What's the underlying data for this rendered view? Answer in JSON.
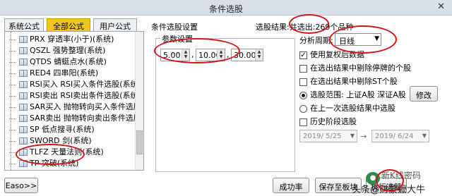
{
  "window": {
    "title": "条件选股",
    "close_glyph": "✕"
  },
  "tabs": [
    {
      "label": "系统公式",
      "active": false
    },
    {
      "label": "全部公式",
      "active": true
    },
    {
      "label": "用户公式",
      "active": false
    }
  ],
  "tree": {
    "items": [
      "PRX 穿透率(小于)(系统)",
      "QSZL 强势整理(系统)",
      "QTDS 蜻蜓点水(系统)",
      "RED4 四串阳(系统)",
      "RSI买入 RSI买入条件选股(系统)",
      "RSI卖出 RSI卖出条件选股(系统)",
      "SAR买入 抛物转向买入条件选股(",
      "SAR卖出 抛物转向卖出条件选股(系",
      "SP 低点搜寻(系统)",
      "SWORD 剑(系统)",
      "TLFZ 天量法则(系统)",
      "TP 突破(系统)"
    ]
  },
  "right": {
    "section_label": "条件选股设置",
    "result_label": "选股结果:共选出:269个品种",
    "params_label": "参数设置",
    "params": [
      "5.00",
      "10.00",
      "30.00"
    ],
    "period_label": "分析周期:",
    "period_value": "日线",
    "options": [
      {
        "label": "使用复权后数据",
        "checked": true
      },
      {
        "label": "在选出结果中剔除停牌的个股",
        "checked": false
      },
      {
        "label": "在选出结果中剔除ST个股",
        "checked": false
      }
    ],
    "scope_radio_1": "选股范围: 上证A股 深证A股",
    "scope_radio_2": "在上一次选股结果中选股",
    "history_label": "历史阶段选股",
    "modify_button": "修改",
    "date_from": "2019/ 5/25",
    "date_to": "2019/ 6/24",
    "date_sep": "→"
  },
  "bottom": {
    "advanced_button": "Easo>>",
    "join_button": "成功率",
    "save_button": "保存至板块",
    "third_button": "执行选股"
  },
  "watermark": {
    "line1": "新K线密码",
    "line2": "头条@财蒙嬷大牛"
  },
  "annotation_color": "#d1141b"
}
